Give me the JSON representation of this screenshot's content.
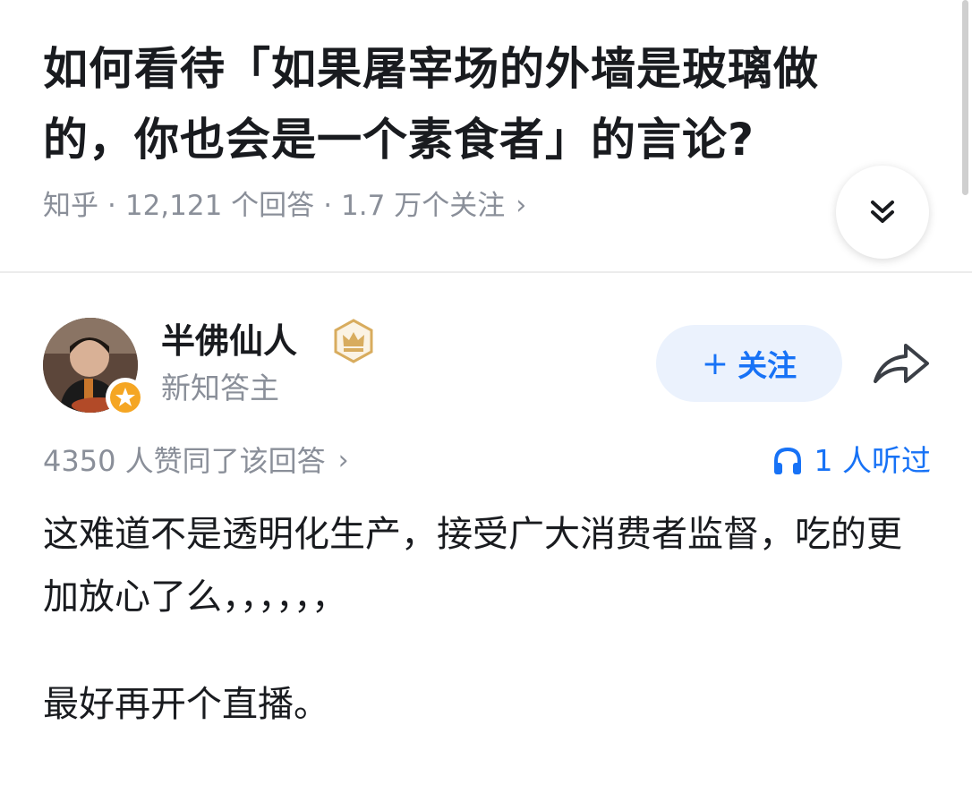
{
  "question": {
    "title": "如何看待「如果屠宰场的外墙是玻璃做的，你也会是一个素食者」的言论?",
    "source": "知乎",
    "answers_count": "12,121 个回答",
    "followers_count": "1.7 万个关注",
    "separator": "·",
    "chevron": "›",
    "collapse_icon": "double-chevron-down-icon"
  },
  "author": {
    "name": "半佛仙人",
    "subtitle": "新知答主",
    "badge_icon": "crown-icon",
    "follow_plus": "+",
    "follow_label": "关注",
    "share_icon": "share-icon"
  },
  "stats": {
    "likes_text": "4350 人赞同了该回答",
    "chevron": "›",
    "listened_text": "1 人听过",
    "listened_icon": "headphones-icon"
  },
  "answer": {
    "paragraph1": "这难道不是透明化生产，接受广大消费者监督，吃的更加放心了么，，，，，，",
    "paragraph2": "最好再开个直播。"
  },
  "colors": {
    "accent": "#1772f6",
    "follow_bg": "#ebf2fd",
    "muted": "#8a8f99",
    "badge_gold": "#d8ac5e",
    "badge_orange": "#f5a623"
  }
}
